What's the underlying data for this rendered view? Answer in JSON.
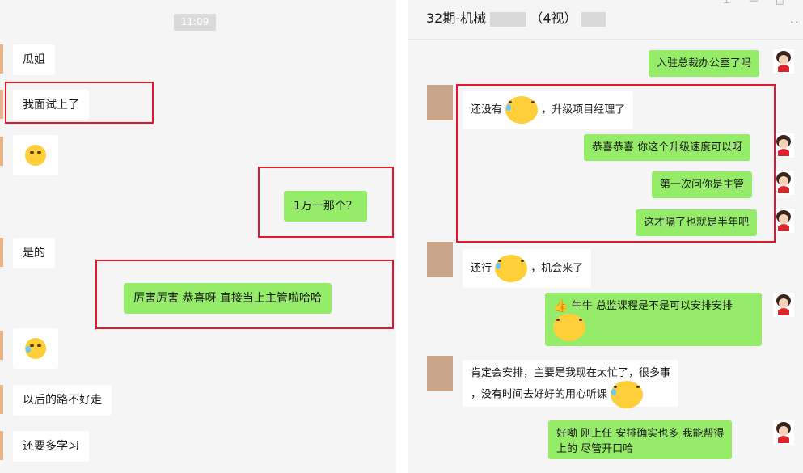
{
  "left_chat": {
    "timestamp": "11:09",
    "messages": [
      {
        "text": "瓜姐"
      },
      {
        "text": "我面试上了"
      },
      {
        "text": "1万一那个？"
      },
      {
        "text": "是的"
      },
      {
        "text": "厉害厉害   恭喜呀   直接当上主管啦哈哈"
      },
      {
        "text": "以后的路不好走"
      },
      {
        "text": "还要多学习"
      }
    ]
  },
  "right_chat": {
    "title_prefix": "32期-机械",
    "title_count": "（4视）",
    "messages": [
      {
        "text": "入驻总裁办公室了吗"
      },
      {
        "text_a": "还没有",
        "text_b": "，升级项目经理了"
      },
      {
        "text": "恭喜恭喜   你这个升级速度可以呀"
      },
      {
        "text": "第一次问你是主管"
      },
      {
        "text": "这才隔了也就是半年吧"
      },
      {
        "text_a": "还行",
        "text_b": "，机会来了"
      },
      {
        "text": "牛牛      总监课程是不是可以安排安排"
      },
      {
        "line1": "肯定会安排，主要是我现在太忙了，很多事",
        "line2": "，没有时间去好好的用心听课"
      },
      {
        "line1": "好嘞    刚上任   安排确实也多    我能帮得",
        "line2": "上的    尽管开口哈"
      }
    ]
  },
  "icons": [
    "thumbs-up-icon",
    "laugh-cry-emoji",
    "grin-emoji",
    "think-emoji",
    "more-icon",
    "minimize-icon",
    "maximize-icon",
    "pin-icon"
  ],
  "colors": {
    "outgoing": "#95ec69",
    "incoming": "#ffffff",
    "highlight": "#e5172b",
    "background": "#f5f5f5"
  }
}
